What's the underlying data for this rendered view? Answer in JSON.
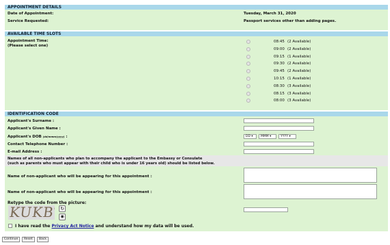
{
  "appointment_details": {
    "header": "APPOINTMENT DETAILS",
    "date_label": "Date of Appointment:",
    "date_value": "Tuesday, March 31, 2020",
    "service_label": "Service Requested:",
    "service_value": "Passport services other than adding pages."
  },
  "time_slots": {
    "header": "AVAILABLE TIME SLOTS",
    "label_line1": "Appointment Time:",
    "label_line2": "(Please select one)",
    "slots": [
      {
        "time": "08:45",
        "avail": "(2 Available)"
      },
      {
        "time": "09:00",
        "avail": "(2 Available)"
      },
      {
        "time": "09:15",
        "avail": "(1 Available)"
      },
      {
        "time": "09:30",
        "avail": "(2 Available)"
      },
      {
        "time": "09:45",
        "avail": "(2 Available)"
      },
      {
        "time": "10:15",
        "avail": "(1 Available)"
      },
      {
        "time": "08:30",
        "avail": "(3 Available)"
      },
      {
        "time": "08:15",
        "avail": "(3 Available)"
      },
      {
        "time": "08:00",
        "avail": "(3 Available)"
      }
    ]
  },
  "identification": {
    "header": "IDENTIFICATION CODE",
    "surname_label": "Applicant's Surname :",
    "given_name_label": "Applicant's Given Name :",
    "dob_label": "Applicant's DOB",
    "dob_hint": "(dd/mmm/yyyy)",
    "dob_colon": ":",
    "dob_day": "DD",
    "dob_month": "MMM",
    "dob_year": "YYYY",
    "phone_label": "Contact Telephone Number :",
    "email_label": "E-mail Address :",
    "names_note_line1": "Names of all non-applicants who plan to accompany the applicant to the Embassy or Consulate",
    "names_note_line2": "(such as parents who must appear with their child who is under 16 years old) should be listed below.",
    "non_applicant_label_1": "Name of non-applicant who will be appearing for this appointment :",
    "non_applicant_label_2": "Name of non-applicant who will be appearing for this appointment :",
    "captcha_label": "Retype the code from the picture:",
    "captcha_text": "KUKBT",
    "privacy_prefix": "I have read the",
    "privacy_link": "Privacy Act Notice",
    "privacy_suffix": "and understand how my data will be used."
  },
  "buttons": {
    "continue": "Continue",
    "reset": "Reset",
    "back": "Back"
  },
  "colors": {
    "section_header": "#a9d7ea",
    "panel_bg": "#ddf3d2",
    "link": "#1a1a9c"
  }
}
